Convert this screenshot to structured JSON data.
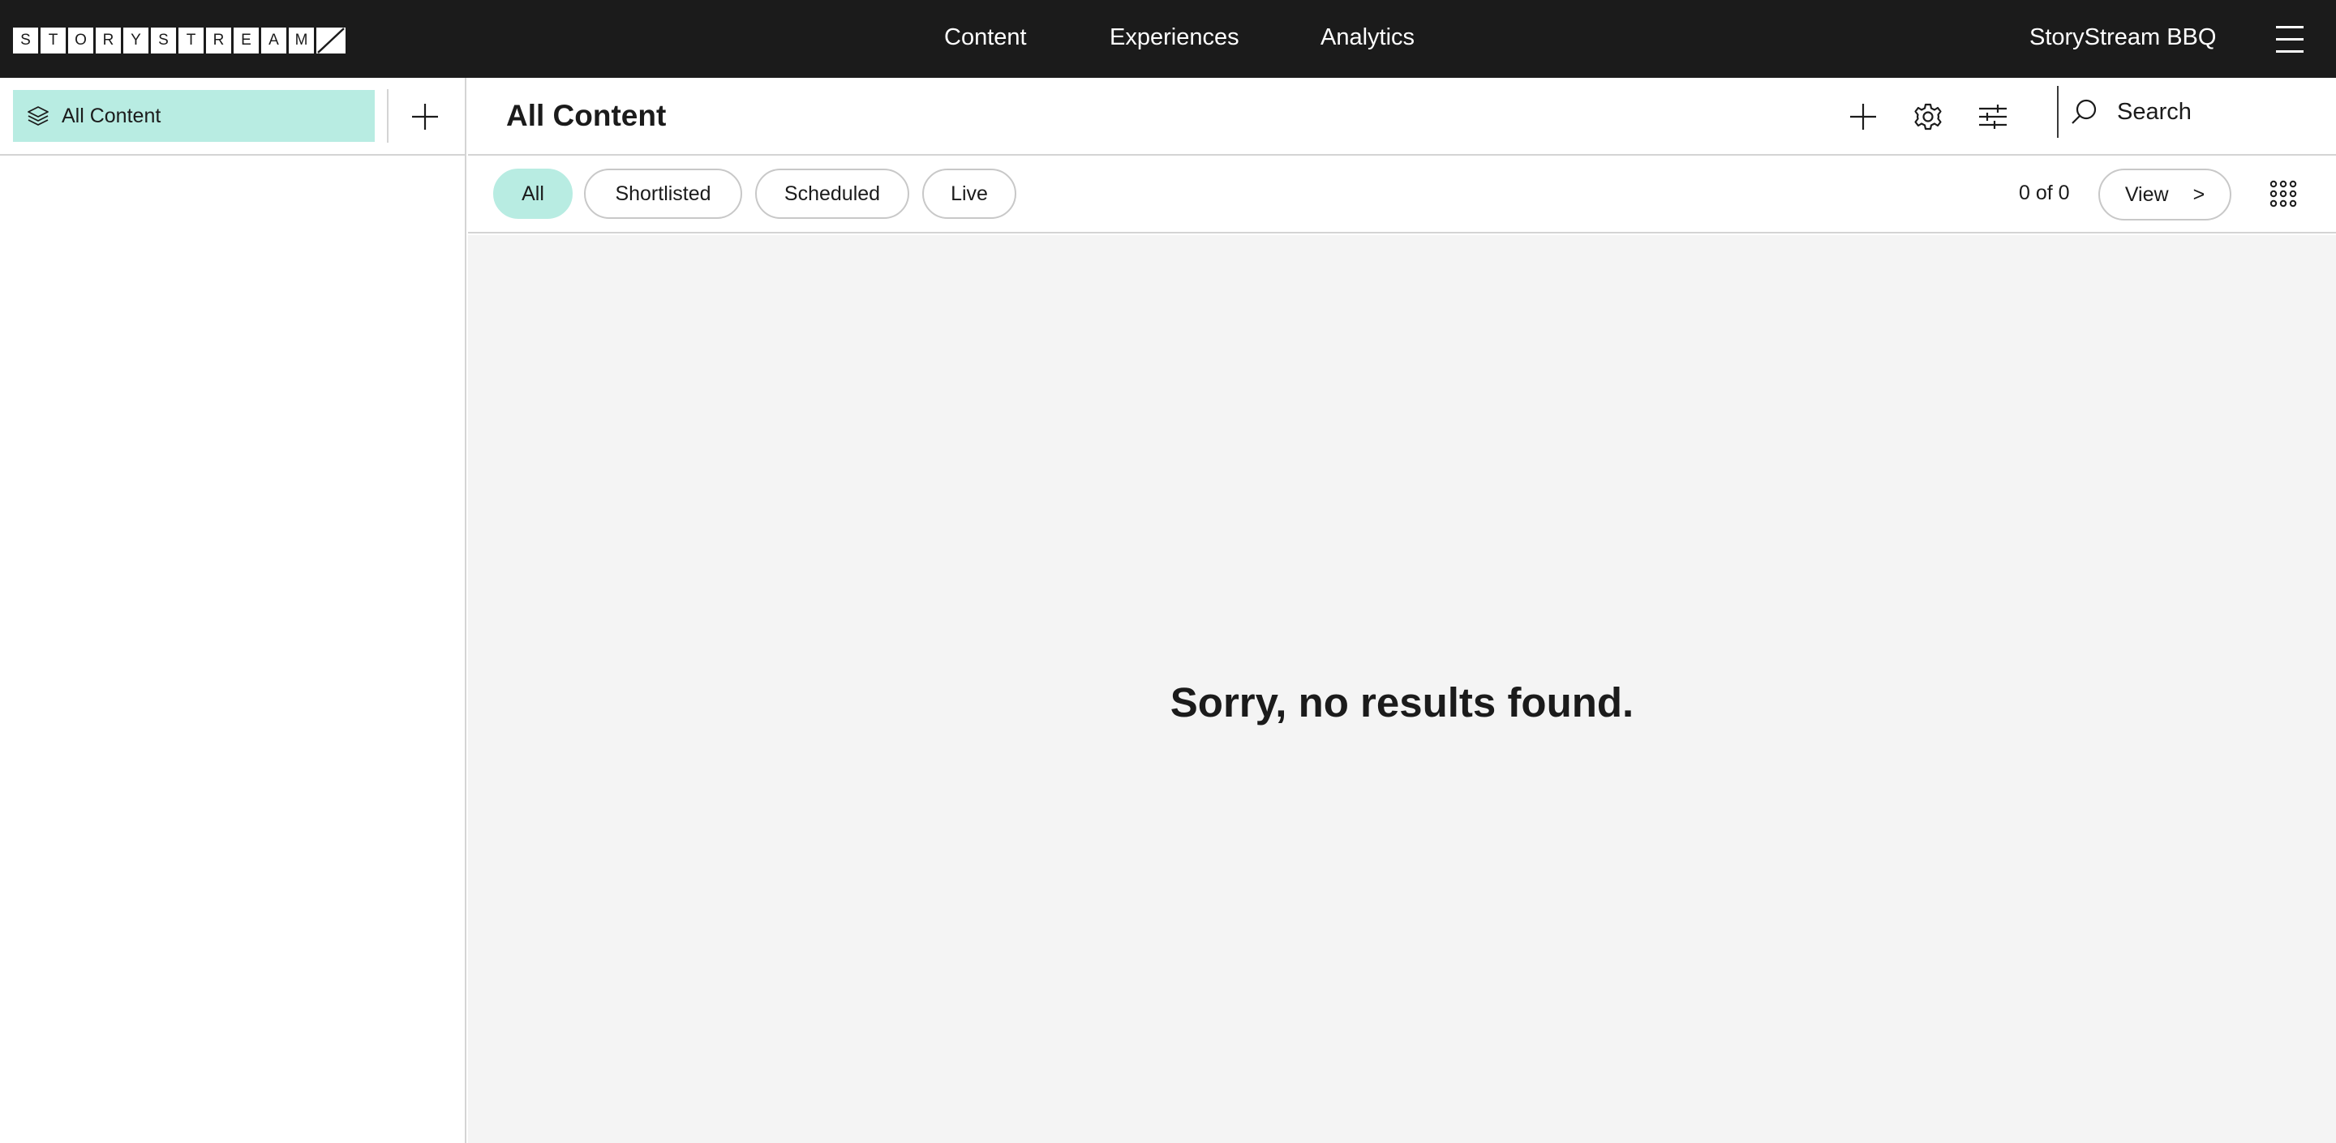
{
  "brand": {
    "logo_letters": [
      "S",
      "T",
      "O",
      "R",
      "Y",
      "S",
      "T",
      "R",
      "E",
      "A",
      "M"
    ]
  },
  "nav": {
    "items": [
      "Content",
      "Experiences",
      "Analytics"
    ],
    "account": "StoryStream BBQ"
  },
  "sidebar": {
    "items": [
      {
        "label": "All Content",
        "icon": "layers-icon"
      }
    ]
  },
  "header": {
    "title": "All Content",
    "search_placeholder": "Search"
  },
  "filters": {
    "tabs": [
      "All",
      "Shortlisted",
      "Scheduled",
      "Live"
    ],
    "active": "All",
    "count": "0 of 0",
    "view_label": "View",
    "view_chevron": ">"
  },
  "main": {
    "empty_message": "Sorry, no results found."
  },
  "colors": {
    "topbar": "#1b1b1b",
    "accent": "#b8ece2",
    "content_bg": "#f4f4f4",
    "border": "#d4d4d4"
  }
}
